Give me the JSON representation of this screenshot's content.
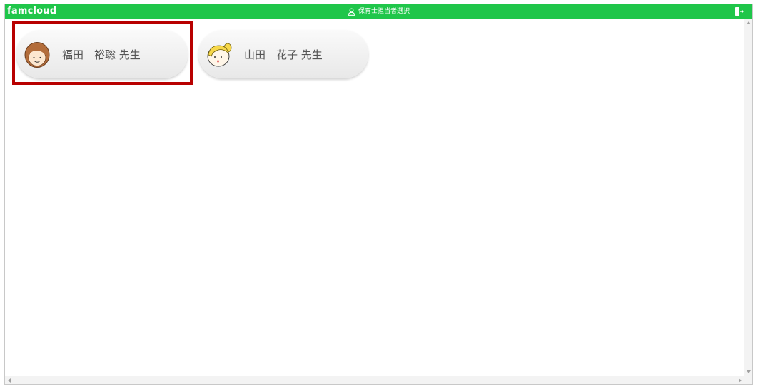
{
  "header": {
    "logo_text": "famcloud",
    "title": "保育士担当者選択",
    "title_icon": "user-icon",
    "logout_icon": "logout-icon",
    "bar_color": "#1fc64a"
  },
  "teachers": [
    {
      "name": "福田　裕聡 先生",
      "avatar": "teacher-avatar-brown-hair",
      "highlighted": true
    },
    {
      "name": "山田　花子 先生",
      "avatar": "teacher-avatar-blonde-ponytail",
      "highlighted": false
    }
  ],
  "highlight_color": "#b80000"
}
